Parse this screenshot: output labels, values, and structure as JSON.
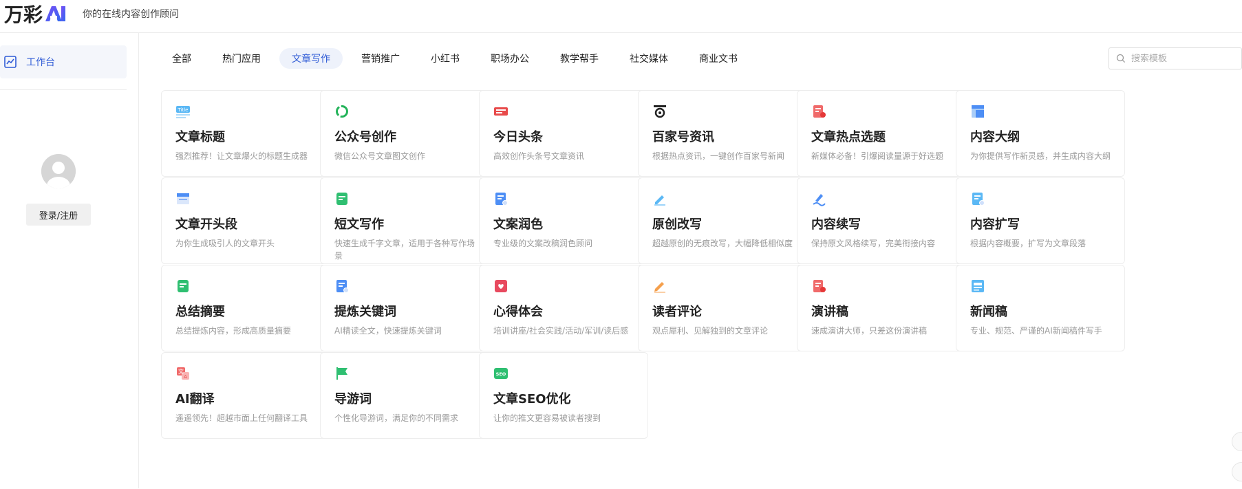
{
  "header": {
    "logo_text": "万彩",
    "logo_icon": "ai-logo-icon",
    "slogan": "你的在线内容创作顾问"
  },
  "sidebar": {
    "workbench_label": "工作台",
    "workbench_icon": "chart-line-icon",
    "login_label": "登录/注册"
  },
  "tabs": [
    {
      "label": "全部",
      "active": false
    },
    {
      "label": "热门应用",
      "active": false
    },
    {
      "label": "文章写作",
      "active": true
    },
    {
      "label": "营销推广",
      "active": false
    },
    {
      "label": "小红书",
      "active": false
    },
    {
      "label": "职场办公",
      "active": false
    },
    {
      "label": "教学帮手",
      "active": false
    },
    {
      "label": "社交媒体",
      "active": false
    },
    {
      "label": "商业文书",
      "active": false
    }
  ],
  "search": {
    "placeholder": "搜索模板"
  },
  "cards": [
    {
      "title": "文章标题",
      "desc": "强烈推荐！让文章爆火的标题生成器",
      "icon": "title-icon",
      "color": "#5bb8f5"
    },
    {
      "title": "公众号创作",
      "desc": "微信公众号文章图文创作",
      "icon": "wechat-icon",
      "color": "#24b35a"
    },
    {
      "title": "今日头条",
      "desc": "高效创作头条号文章资讯",
      "icon": "toutiao-icon",
      "color": "#e84a4a"
    },
    {
      "title": "百家号资讯",
      "desc": "根据热点资讯，一键创作百家号新闻",
      "icon": "baijiahao-icon",
      "color": "#222222"
    },
    {
      "title": "文章热点选题",
      "desc": "新媒体必备！引爆阅读量源于好选题",
      "icon": "hot-topic-icon",
      "color": "#f06a6a"
    },
    {
      "title": "内容大纲",
      "desc": "为你提供写作新灵感，并生成内容大纲",
      "icon": "outline-icon",
      "color": "#4d8ef5"
    },
    {
      "title": "文章开头段",
      "desc": "为你生成吸引人的文章开头",
      "icon": "opening-icon",
      "color": "#4d8ef5"
    },
    {
      "title": "短文写作",
      "desc": "快速生成千字文章，适用于各种写作场景",
      "icon": "short-article-icon",
      "color": "#2fbf71"
    },
    {
      "title": "文案润色",
      "desc": "专业级的文案改稿润色顾问",
      "icon": "polish-icon",
      "color": "#4d8ef5"
    },
    {
      "title": "原创改写",
      "desc": "超越原创的无痕改写，大幅降低相似度",
      "icon": "rewrite-icon",
      "color": "#5bb8f5"
    },
    {
      "title": "内容续写",
      "desc": "保持原文风格续写，完美衔接内容",
      "icon": "continue-icon",
      "color": "#4d8ef5"
    },
    {
      "title": "内容扩写",
      "desc": "根据内容概要，扩写为文章段落",
      "icon": "expand-icon",
      "color": "#5bb8f5"
    },
    {
      "title": "总结摘要",
      "desc": "总结提炼内容，形成高质量摘要",
      "icon": "summary-icon",
      "color": "#2fbf71"
    },
    {
      "title": "提炼关键词",
      "desc": "AI精读全文，快速提炼关键词",
      "icon": "keyword-icon",
      "color": "#4d8ef5"
    },
    {
      "title": "心得体会",
      "desc": "培训讲座/社会实践/活动/军训/读后感",
      "icon": "heart-note-icon",
      "color": "#e84a5f"
    },
    {
      "title": "读者评论",
      "desc": "观点犀利、见解独到的文章评论",
      "icon": "pencil-icon",
      "color": "#f5a04d"
    },
    {
      "title": "演讲稿",
      "desc": "速成演讲大师，只差这份演讲稿",
      "icon": "speech-icon",
      "color": "#f06a6a"
    },
    {
      "title": "新闻稿",
      "desc": "专业、规范、严谨的AI新闻稿件写手",
      "icon": "news-icon",
      "color": "#5bb8f5"
    },
    {
      "title": "AI翻译",
      "desc": "遥遥领先！超越市面上任何翻译工具",
      "icon": "translate-icon",
      "color": "#f06a6a"
    },
    {
      "title": "导游词",
      "desc": "个性化导游词，满足你的不同需求",
      "icon": "flag-icon",
      "color": "#2fbf71"
    },
    {
      "title": "文章SEO优化",
      "desc": "让你的推文更容易被读者搜到",
      "icon": "seo-icon",
      "color": "#2fbf71"
    }
  ]
}
